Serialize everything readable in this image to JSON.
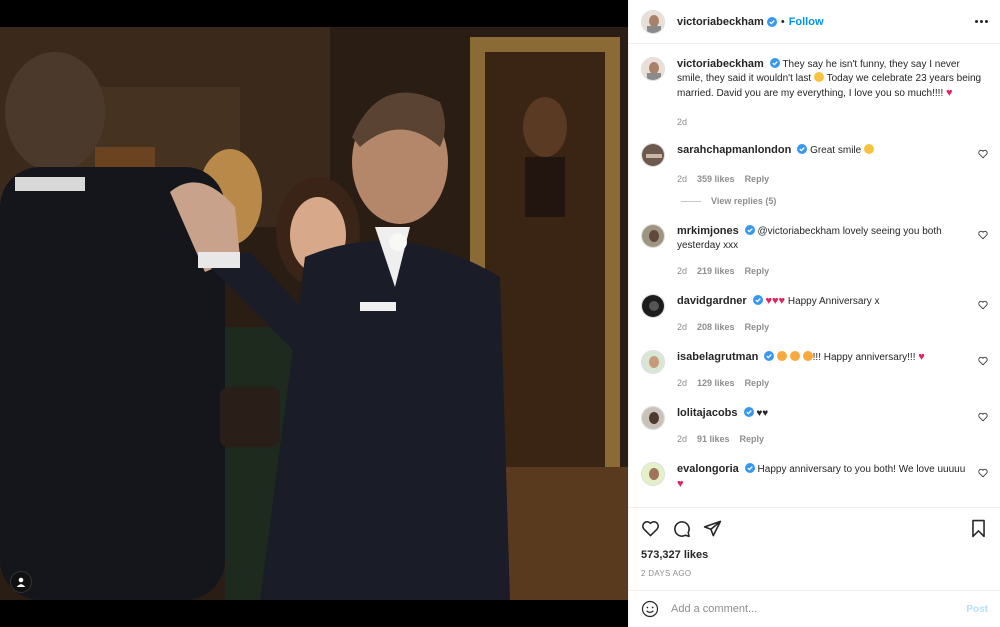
{
  "post": {
    "author": "victoriabeckham",
    "follow_label": "Follow",
    "caption_parts": [
      "They say he isn't funny, they say I never smile, they said it wouldn't last ",
      " Today we celebrate 23 years being married. David you are my everything, I love you so much!!!! "
    ],
    "caption_age": "2d"
  },
  "comments": [
    {
      "user": "sarahchapmanlondon",
      "text": "Great smile ",
      "age": "2d",
      "likes": "359 likes",
      "reply": "Reply",
      "view_replies": "View replies (5)"
    },
    {
      "user": "mrkimjones",
      "text": "@victoriabeckham lovely seeing you both yesterday xxx",
      "age": "2d",
      "likes": "219 likes",
      "reply": "Reply"
    },
    {
      "user": "davidgardner",
      "text": " Happy Anniversary x",
      "age": "2d",
      "likes": "208 likes",
      "reply": "Reply"
    },
    {
      "user": "isabelagrutman",
      "text": "!!! Happy anniversary!!! ",
      "age": "2d",
      "likes": "129 likes",
      "reply": "Reply"
    },
    {
      "user": "lolitajacobs",
      "text": "♥♥",
      "age": "2d",
      "likes": "91 likes",
      "reply": "Reply"
    },
    {
      "user": "evalongoria",
      "text": "Happy anniversary to you both! We love uuuuu ",
      "age": "",
      "likes": "",
      "reply": ""
    }
  ],
  "stats": {
    "likes": "573,327 likes",
    "date": "2 DAYS AGO"
  },
  "composer": {
    "placeholder": "Add a comment...",
    "post_label": "Post"
  },
  "colors": {
    "accent": "#0095f6",
    "verified": "#3897f0",
    "heart_red": "#e0245e"
  }
}
